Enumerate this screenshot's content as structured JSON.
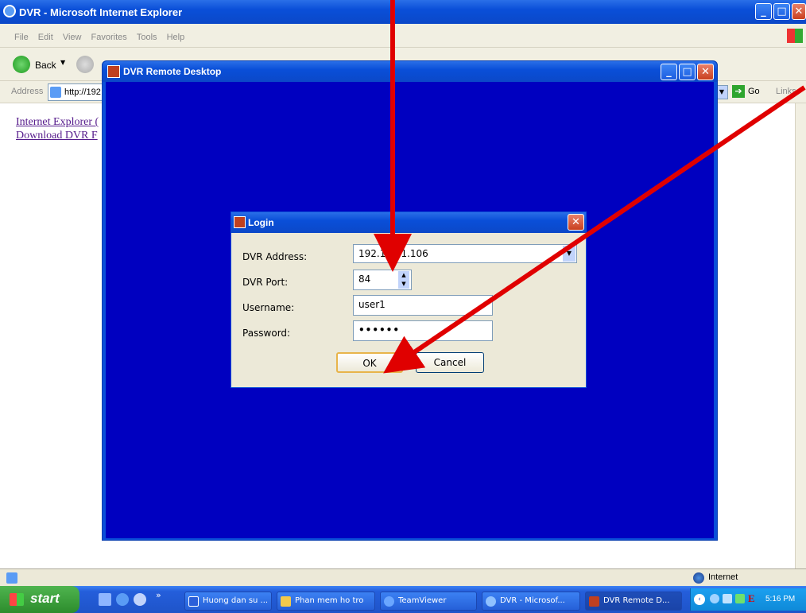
{
  "ie_window": {
    "title": "DVR - Microsoft Internet Explorer",
    "menu": [
      "File",
      "Edit",
      "View",
      "Favorites",
      "Tools",
      "Help"
    ],
    "back_label": "Back",
    "address_label": "Address",
    "address_value": "http://192",
    "go_label": "Go",
    "links_label": "Links",
    "page_links": [
      "Internet Explorer (",
      "Download DVR F"
    ],
    "status_zone": "Internet"
  },
  "remote_window": {
    "title": "DVR Remote Desktop",
    "background_color": "#0000c0"
  },
  "login_dialog": {
    "title": "Login",
    "fields": [
      {
        "label": "DVR Address:",
        "value": "192.168.1.106"
      },
      {
        "label": "DVR Port:",
        "value": "84"
      },
      {
        "label": "Username:",
        "value": "user1"
      },
      {
        "label": "Password:",
        "value": "••••••"
      }
    ],
    "ok_label": "OK",
    "cancel_label": "Cancel"
  },
  "taskbar": {
    "start_label": "start",
    "items": [
      {
        "label": "Huong dan su ...",
        "icon": "word-icon",
        "color": "#2b5fd9"
      },
      {
        "label": "Phan mem ho tro",
        "icon": "folder-icon",
        "color": "#f3c94b"
      },
      {
        "label": "TeamViewer",
        "icon": "teamviewer-icon",
        "color": "#6aa6ff"
      },
      {
        "label": "DVR - Microsof...",
        "icon": "ie-icon",
        "color": "#8fc1ff"
      },
      {
        "label": "DVR Remote D...",
        "icon": "dvr-icon",
        "color": "#c04020"
      }
    ],
    "clock": "5:16 PM"
  },
  "colors": {
    "xp_blue": "#0a4fd8",
    "remote_bg": "#0000c0",
    "arrow": "#e00000",
    "taskbar": "#245edb"
  }
}
